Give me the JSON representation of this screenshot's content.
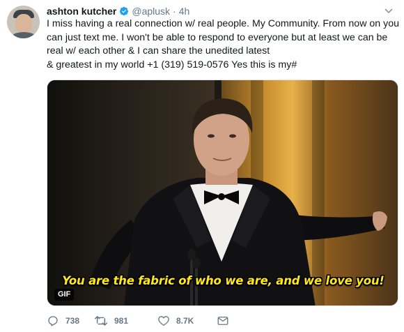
{
  "tweet": {
    "author_name": "ashton kutcher",
    "handle": "@aplusk",
    "separator": "·",
    "time": "4h",
    "lines": [
      "I miss having a real connection w/ real people. My Community. From now on you",
      "can just text me. I won't be able to respond to everyone but at least we can be",
      "real w/ each other & I can share the unedited latest",
      "& greatest in my world +1 (319) 519-0576 Yes this is my#"
    ],
    "media": {
      "caption": "You are the fabric of who we are, and we love you!",
      "badge": "GIF"
    },
    "stats": {
      "replies": "738",
      "retweets": "981",
      "likes": "8.7K"
    }
  },
  "icons": {
    "verified": "verified-badge-icon",
    "menu": "chevron-down-icon",
    "reply": "reply-icon",
    "retweet": "retweet-icon",
    "like": "heart-icon",
    "message": "direct-message-icon"
  },
  "colors": {
    "verified": "#1da1f2",
    "text": "#14171a",
    "secondary": "#657786",
    "caption": "#ffe81a"
  }
}
